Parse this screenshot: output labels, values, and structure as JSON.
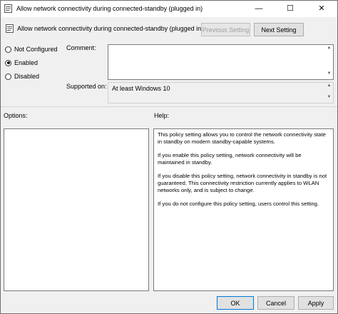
{
  "window": {
    "title": "Allow network connectivity during connected-standby (plugged in)",
    "minimize_glyph": "—",
    "maximize_glyph": "☐",
    "close_glyph": "✕"
  },
  "header": {
    "title": "Allow network connectivity during connected-standby (plugged in)",
    "previous_label": "Previous Setting",
    "next_label": "Next Setting"
  },
  "state": {
    "options": [
      {
        "label": "Not Configured",
        "checked": false
      },
      {
        "label": "Enabled",
        "checked": true
      },
      {
        "label": "Disabled",
        "checked": false
      }
    ]
  },
  "comment": {
    "label": "Comment:",
    "value": ""
  },
  "supported": {
    "label": "Supported on:",
    "value": "At least Windows 10"
  },
  "options_panel": {
    "label": "Options:"
  },
  "help_panel": {
    "label": "Help:",
    "paragraphs": [
      "This policy setting allows you to control the network connectivity state in standby on modern standby-capable systems.",
      "If you enable this policy setting, network connectivity will be maintained in standby.",
      "If you disable this policy setting, network connectivity in standby is not guaranteed. This connectivity restriction currently applies to WLAN networks only, and is subject to change.",
      "If you do not configure this policy setting, users control this setting."
    ]
  },
  "footer": {
    "ok_label": "OK",
    "cancel_label": "Cancel",
    "apply_label": "Apply"
  },
  "icons": {
    "policy": "policy-setting-icon",
    "scroll_up": "scroll-up-arrow",
    "scroll_down": "scroll-down-arrow"
  }
}
